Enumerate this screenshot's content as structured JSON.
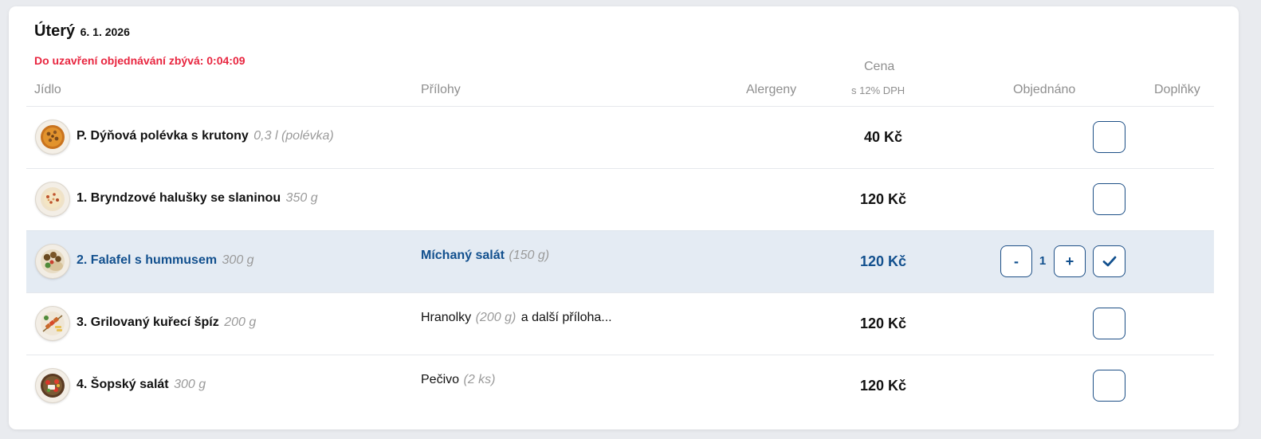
{
  "day": {
    "name": "Úterý",
    "date": "6. 1. 2026"
  },
  "countdown": "Do uzavření objednávání zbývá: 0:04:09",
  "columns": {
    "meal": "Jídlo",
    "sides": "Přílohy",
    "allergens": "Alergeny",
    "price": "Cena",
    "price_note": "s 12% DPH",
    "ordered": "Objednáno",
    "extras": "Doplňky"
  },
  "meals": [
    {
      "name": "P. Dýňová polévka s krutony",
      "amount": "0,3 l (polévka)",
      "side": "",
      "side_amount": "",
      "side_more": "",
      "price": "40 Kč",
      "ordered": false,
      "quantity": "",
      "thumb_icon": "pumpkin-soup-icon"
    },
    {
      "name": "1. Bryndzové halušky se slaninou",
      "amount": "350 g",
      "side": "",
      "side_amount": "",
      "side_more": "",
      "price": "120 Kč",
      "ordered": false,
      "quantity": "",
      "thumb_icon": "halusky-icon"
    },
    {
      "name": "2. Falafel s hummusem",
      "amount": "300 g",
      "side": "Míchaný salát",
      "side_amount": "(150 g)",
      "side_more": "",
      "price": "120 Kč",
      "ordered": true,
      "quantity": "1",
      "thumb_icon": "falafel-icon"
    },
    {
      "name": "3. Grilovaný kuřecí špíz",
      "amount": "200 g",
      "side": "Hranolky",
      "side_amount": "(200 g)",
      "side_more": "a další příloha...",
      "price": "120 Kč",
      "ordered": false,
      "quantity": "",
      "thumb_icon": "chicken-skewer-icon"
    },
    {
      "name": "4. Šopský salát",
      "amount": "300 g",
      "side": "Pečivo",
      "side_amount": "(2 ks)",
      "side_more": "",
      "price": "120 Kč",
      "ordered": false,
      "quantity": "",
      "thumb_icon": "shopska-salad-icon"
    }
  ],
  "controls": {
    "minus": "-",
    "plus": "+"
  },
  "colors": {
    "accent": "#12508e",
    "warning": "#e8253f",
    "selected_row": "#e4ebf3"
  }
}
